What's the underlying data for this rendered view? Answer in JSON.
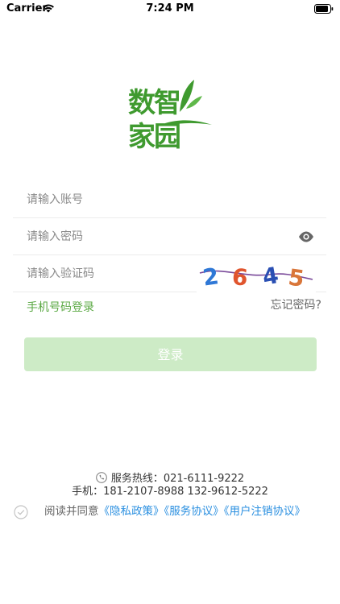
{
  "status_bar": {
    "carrier": "Carrier",
    "time": "7:24 PM"
  },
  "logo": {
    "line1": "数智",
    "line2": "家园",
    "color": "#3f9a2f"
  },
  "form": {
    "username_placeholder": "请输入账号",
    "password_placeholder": "请输入密码",
    "captcha_placeholder": "请输入验证码",
    "captcha_digits": [
      "2",
      "6",
      "4",
      "5"
    ],
    "phone_login_label": "手机号码登录",
    "forgot_password_label": "忘记密码?",
    "login_button_label": "登录"
  },
  "footer": {
    "hotline": "服务热线：021-6111-9222",
    "mobile": "手机：181-2107-8988 132-9612-5222",
    "agree_prefix": "阅读并同意",
    "privacy_policy": "《隐私政策》",
    "service_agreement": "《服务协议》",
    "cancellation_agreement": "《用户注销协议》"
  },
  "colors": {
    "accent_green": "#5aa843",
    "button_disabled": "#cdebc6",
    "link_blue": "#2a8fe0"
  },
  "icons": {
    "wifi": "wifi-icon",
    "battery": "battery-icon",
    "eye": "eye-icon",
    "phone": "phone-icon",
    "check": "checkbox-circle-icon"
  }
}
